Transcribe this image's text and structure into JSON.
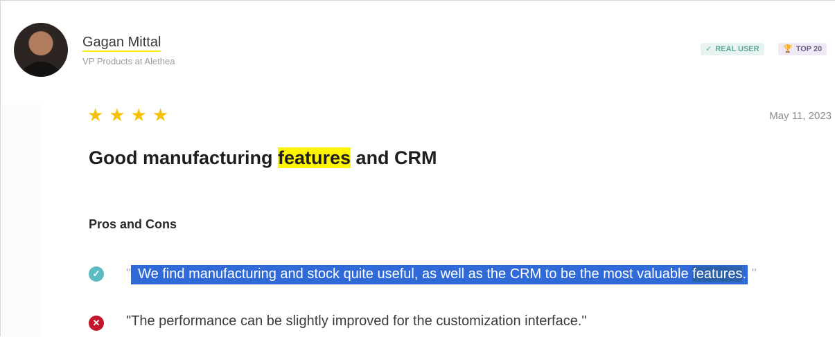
{
  "author": {
    "name": "Gagan Mittal",
    "title": "VP Products at Alethea"
  },
  "badges": {
    "real_user": {
      "icon": "✓",
      "label": "REAL USER"
    },
    "top": {
      "icon": "🏆",
      "label": "TOP 20"
    }
  },
  "review": {
    "rating": 4,
    "stars": "★★★★",
    "date": "May 11, 2023",
    "title_before": "Good manufacturing ",
    "title_highlight": "features",
    "title_after": " and CRM"
  },
  "pros_cons": {
    "heading": "Pros and Cons",
    "pro": {
      "icon": "✓",
      "open_quote": "\"",
      "text_before": "We find manufacturing and stock quite useful, as well as the CRM to be the most valuable ",
      "keyword": "features",
      "text_after": ".",
      "close_quote": "\""
    },
    "con": {
      "icon": "✕",
      "text": "\"The performance can be slightly improved for the customization interface.\""
    }
  },
  "colors": {
    "highlight": "#fff500",
    "selection": "#2f6ad8",
    "star": "#f5c10a",
    "pro_icon": "#5cbcc2",
    "con_icon": "#c4152d"
  }
}
